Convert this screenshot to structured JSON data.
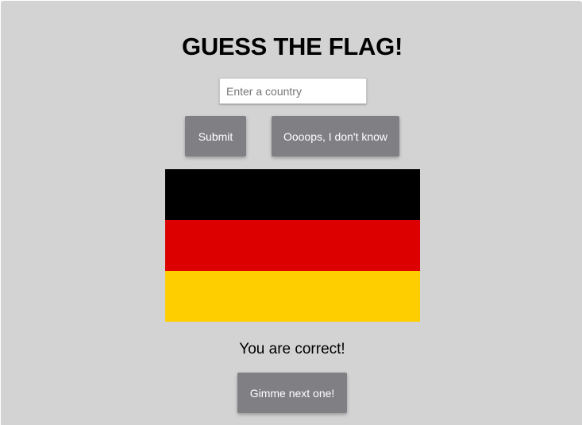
{
  "game": {
    "title": "GUESS THE FLAG!",
    "country_input": {
      "value": "",
      "placeholder": "Enter a country"
    },
    "submit_label": "Submit",
    "dont_know_label": "Oooops, I don't know",
    "result_message": "You are correct!",
    "next_label": "Gimme next one!"
  },
  "flag": {
    "country": "Germany",
    "stripes": [
      "#000000",
      "#dd0000",
      "#ffce00"
    ]
  },
  "colors": {
    "background": "#d3d3d3",
    "button": "#807f84",
    "button_text": "#ffffff"
  }
}
